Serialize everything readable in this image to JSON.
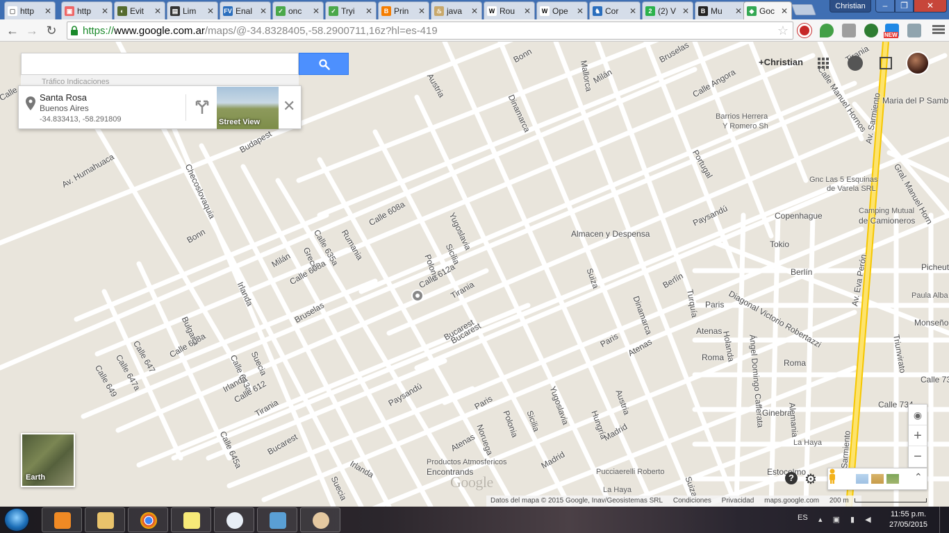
{
  "browser": {
    "tabs": [
      {
        "label": "http",
        "color": "#ffffff",
        "fg": "#666"
      },
      {
        "label": "http",
        "color": "#e66",
        "fg": "#fff"
      },
      {
        "label": "Evit",
        "color": "#556b2f",
        "fg": "#fff"
      },
      {
        "label": "Lim",
        "color": "#333333",
        "fg": "#fff"
      },
      {
        "label": "Enal",
        "color": "#2a6ebd",
        "fg": "#fff"
      },
      {
        "label": "onc",
        "color": "#4aa84a",
        "fg": "#fff"
      },
      {
        "label": "Tryi",
        "color": "#4aa84a",
        "fg": "#fff"
      },
      {
        "label": "Prin",
        "color": "#f57d00",
        "fg": "#fff"
      },
      {
        "label": "java",
        "color": "#c8a86b",
        "fg": "#fff"
      },
      {
        "label": "Rou",
        "color": "#ffffff",
        "fg": "#000"
      },
      {
        "label": "Ope",
        "color": "#ffffff",
        "fg": "#000"
      },
      {
        "label": "Cor",
        "color": "#2a6ebd",
        "fg": "#fff"
      },
      {
        "label": "(2) V",
        "color": "#2bb24c",
        "fg": "#fff"
      },
      {
        "label": "Mu",
        "color": "#222222",
        "fg": "#fff"
      },
      {
        "label": "Goc",
        "color": "#34a853",
        "fg": "#fff"
      }
    ],
    "fav_glyphs": [
      "▢",
      "▣",
      "◐",
      "▤",
      "FV",
      "✓",
      "✓",
      "B",
      "♨",
      "W",
      "W",
      "♞",
      "2",
      "B",
      "◆"
    ],
    "profile_name": "Christian",
    "url": {
      "scheme": "https://",
      "host": "www.google.com.ar",
      "path": "/maps/@-34.8328405,-58.2900711,16z?hl=es-419"
    },
    "new_badge": "NEW"
  },
  "maps": {
    "search": {
      "placeholder": "",
      "value": ""
    },
    "subbar_text": "Tráfico  Indicaciones",
    "place_card": {
      "name": "Santa Rosa",
      "region": "Buenos Aires",
      "coords": "-34.833413, -58.291809",
      "street_view_label": "Street View"
    },
    "account": {
      "plus_name": "+Christian"
    },
    "earth_label": "Earth",
    "logo": "Google",
    "attribution": [
      "Datos del mapa © 2015 Google, Inav/Geosistemas SRL",
      "Condiciones",
      "Privacidad",
      "maps.google.com",
      "200 m"
    ],
    "streets": [
      "Austria",
      "Bonn",
      "Dinamarca",
      "Mallorca",
      "Milán",
      "Bruselas",
      "Calle Angora",
      "Calle Manuel Hornos",
      "Tirania",
      "Maria del P Sambra",
      "Barrios Herrera",
      "Y Romero Sh",
      "Av. Sarmiento",
      "Portugal",
      "Gral. Manuel Horn",
      "Gnc Las 5 Esquinas",
      "de Varela SRL",
      "Camping Mutual",
      "de Camioneros",
      "Copenhague",
      "Paysandú",
      "Tokio",
      "Almacen y Despensa",
      "Yugoslavia",
      "Sicilia",
      "Polonia",
      "Calle 608a",
      "Rumania",
      "Calle 635a",
      "Grecia",
      "Checoslovaquia",
      "Budapest",
      "Av. Humahuaca",
      "Calle",
      "Bonn",
      "Milán",
      "Calle 608a",
      "Irlanda",
      "Calle 612a",
      "Tirania",
      "Bucarest",
      "Suiza",
      "Dinamarca",
      "Berlín",
      "Turquía",
      "Diagonal Victorio Robertazzi",
      "Paris",
      "Berlín",
      "Picheut",
      "Paula Alba",
      "Monseño",
      "Triunvirato",
      "Atenas",
      "Holanda",
      "Ángel Domingo Cafferata",
      "Roma",
      "Roma",
      "Calle 73",
      "Calle 734",
      "Ginebra",
      "Alemania",
      "La Haya",
      "Estocolmo",
      "Av. Eva Perón",
      "Bulgaria",
      "Calle 647",
      "Calle 647a",
      "Calle 649",
      "Calle 608a",
      "Calle 643a",
      "Suecia",
      "Bruselas",
      "Irlanda",
      "Calle 612",
      "Tirania",
      "Calle 645a",
      "Bucarest",
      "Paysandú",
      "Paris",
      "Noruega",
      "Polonia",
      "Sicilia",
      "Atenas",
      "Yugoslavia",
      "Hungría",
      "Austria",
      "Madrid",
      "Madrid",
      "Suecia",
      "Irlanda",
      "Productos Atmosfericos",
      "Encontrands",
      "Pucciaerelli Roberto",
      "La Haya",
      "Suiza",
      "Paris",
      "Atenas",
      "Bucarest",
      "Onti",
      "Sarmiento"
    ]
  },
  "taskbar": {
    "lang": "ES",
    "time": "11:55 p.m.",
    "date": "27/05/2015",
    "items": [
      "media-player",
      "file-explorer",
      "chrome",
      "sticky-notes",
      "browser",
      "photos",
      "paint"
    ]
  }
}
